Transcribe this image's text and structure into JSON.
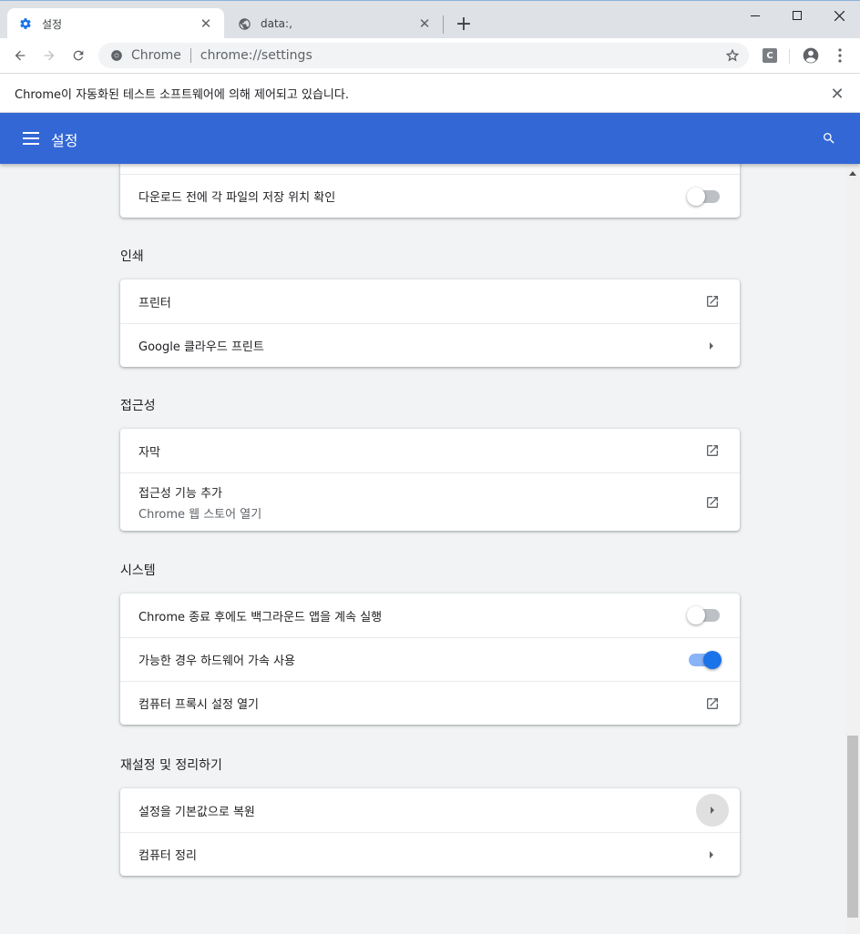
{
  "browser": {
    "tabs": [
      {
        "title": "설정",
        "icon": "gear-icon",
        "active": true
      },
      {
        "title": "data:,",
        "icon": "globe-icon",
        "active": false
      }
    ],
    "omnibox": {
      "origin": "Chrome",
      "url": "chrome://settings"
    },
    "extension_label": "C",
    "infobar_text": "Chrome이 자동화된 테스트 소프트웨어에 의해 제어되고 있습니다."
  },
  "header": {
    "title": "설정"
  },
  "downloads": {
    "ask_location_label": "다운로드 전에 각 파일의 저장 위치 확인",
    "ask_location_on": false
  },
  "printing": {
    "title": "인쇄",
    "printers_label": "프린터",
    "cloud_print_label": "Google 클라우드 프린트"
  },
  "accessibility": {
    "title": "접근성",
    "captions_label": "자막",
    "add_features_label": "접근성 기능 추가",
    "add_features_sublabel": "Chrome 웹 스토어 열기"
  },
  "system": {
    "title": "시스템",
    "background_apps_label": "Chrome 종료 후에도 백그라운드 앱을 계속 실행",
    "background_apps_on": false,
    "hardware_accel_label": "가능한 경우 하드웨어 가속 사용",
    "hardware_accel_on": true,
    "proxy_label": "컴퓨터 프록시 설정 열기"
  },
  "reset": {
    "title": "재설정 및 정리하기",
    "restore_label": "설정을 기본값으로 복원",
    "cleanup_label": "컴퓨터 정리"
  },
  "colors": {
    "header_blue": "#3367d6",
    "toggle_on": "#1a73e8",
    "background": "#f1f3f4"
  }
}
